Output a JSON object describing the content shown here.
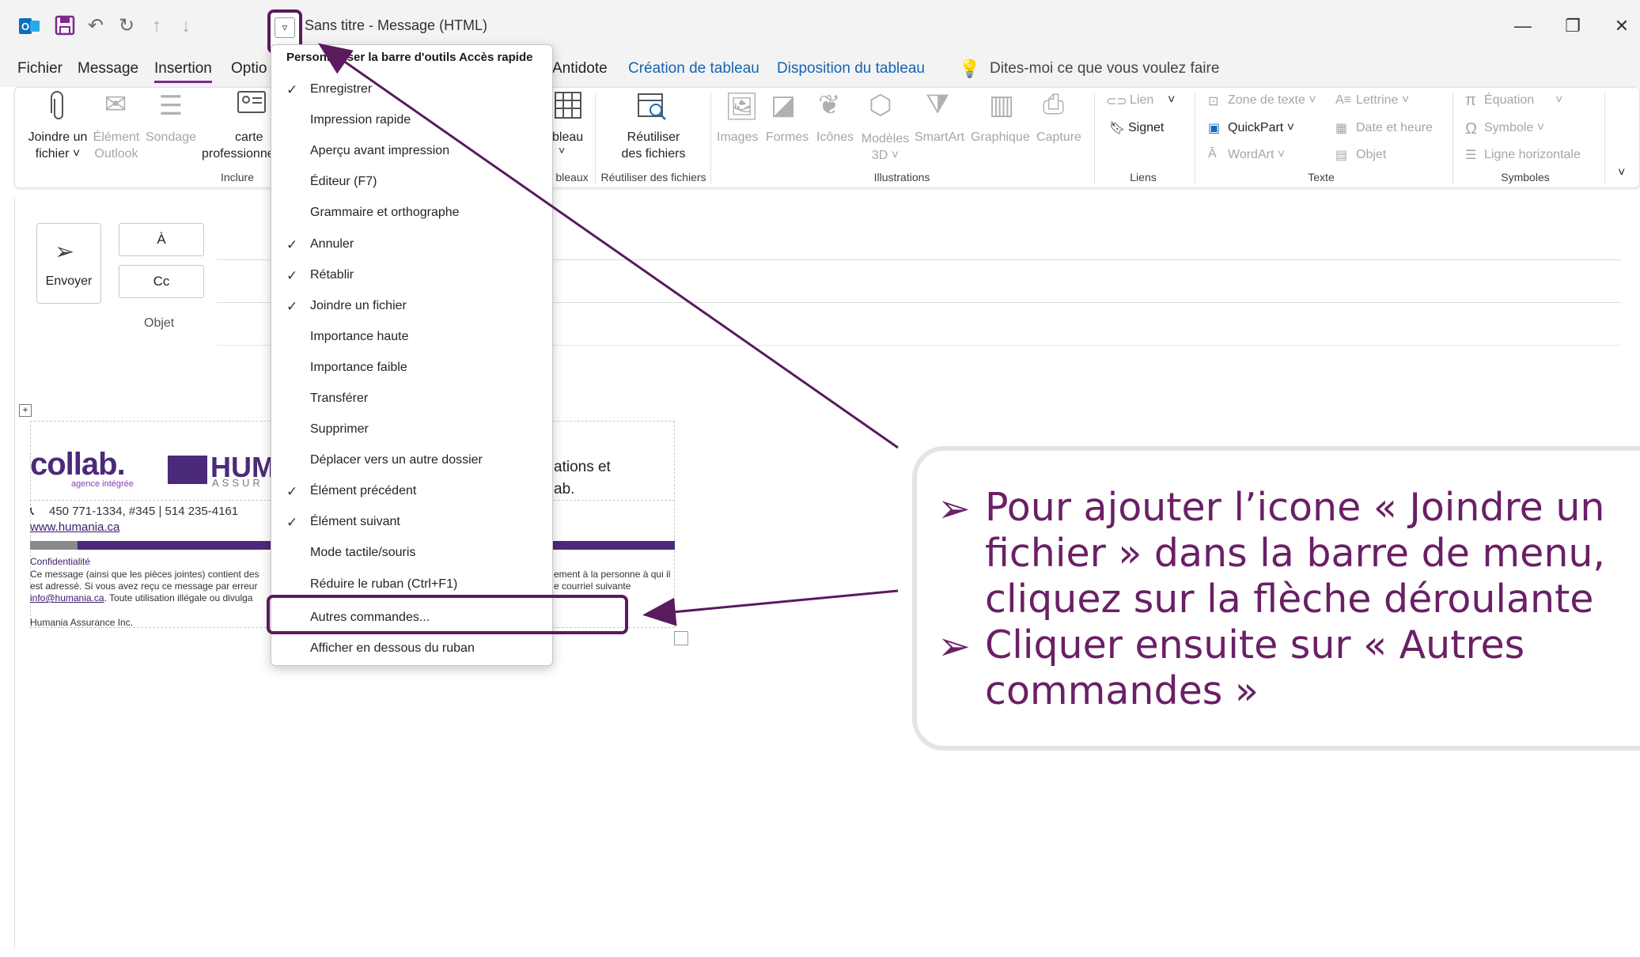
{
  "window": {
    "title": "Sans titre  -  Message (HTML)",
    "minimize": "—",
    "restore": "❐",
    "close": "✕"
  },
  "tabs": {
    "fichier": "Fichier",
    "message": "Message",
    "insertion": "Insertion",
    "options": "Optio",
    "antidote": "Antidote",
    "creation_tableau": "Création de tableau",
    "disposition_tableau": "Disposition du tableau",
    "tell_me": "Dites-moi ce que vous voulez faire"
  },
  "ribbon": {
    "joindre": "Joindre un",
    "joindre2": "fichier ˅",
    "element": "Élément",
    "element2": "Outlook",
    "sondage": "Sondage",
    "carte": "carte",
    "carte2": "professionne",
    "inclure": "Inclure",
    "tableau": "bleau",
    "tableaux": "bleaux",
    "reutiliser": "Réutiliser",
    "reutiliser2": "des fichiers",
    "reutiliser_group": "Réutiliser des fichiers",
    "images": "Images",
    "formes": "Formes",
    "icones": "Icônes",
    "modeles": "Modèles",
    "modeles2": "3D ˅",
    "smartart": "SmartArt",
    "graphique": "Graphique",
    "capture": "Capture",
    "illustrations": "Illustrations",
    "lien": "Lien",
    "signet": "Signet",
    "liens": "Liens",
    "zone_texte": "Zone de texte ˅",
    "lettrine": "Lettrine ˅",
    "quickpart": "QuickPart ˅",
    "date_heure": "Date et heure",
    "wordart": "WordArt ˅",
    "objet": "Objet",
    "texte": "Texte",
    "equation": "Équation",
    "symbole": "Symbole ˅",
    "ligne_horizontale": "Ligne horizontale",
    "symboles": "Symboles"
  },
  "compose": {
    "send": "Envoyer",
    "to": "À",
    "cc": "Cc",
    "subject": "Objet"
  },
  "signature": {
    "logo1": "collab.",
    "logo1_sub": "agence intégrée",
    "logo2": "HUM",
    "logo2_sub": "ASSUR",
    "side_text1": "ations et",
    "side_text2": "ab.",
    "phone": "450 771-1334, #345  |  514 235-4161",
    "website": "www.humania.ca",
    "conf_title": "Confidentialité",
    "conf_line1": "Ce message (ainsi que les pièces jointes) contient des",
    "conf_line1b": "ement à la personne à qui il",
    "conf_line2": "est adressé. Si vous avez reçu ce message par erreur",
    "conf_line2b": "e courriel suivante",
    "conf_email": "info@humania.ca",
    "conf_line3": ". Toute utilisation illégale ou divulga",
    "company": "Humania Assurance Inc."
  },
  "menu": {
    "title": "Personnaliser la barre d'outils Accès rapide",
    "items": [
      {
        "label": "Enregistrer",
        "checked": true
      },
      {
        "label": "Impression rapide",
        "checked": false
      },
      {
        "label": "Aperçu avant impression",
        "checked": false
      },
      {
        "label": "Éditeur (F7)",
        "checked": false
      },
      {
        "label": "Grammaire et orthographe",
        "checked": false
      },
      {
        "label": "Annuler",
        "checked": true
      },
      {
        "label": "Rétablir",
        "checked": true
      },
      {
        "label": "Joindre un fichier",
        "checked": true
      },
      {
        "label": "Importance haute",
        "checked": false
      },
      {
        "label": "Importance faible",
        "checked": false
      },
      {
        "label": "Transférer",
        "checked": false
      },
      {
        "label": "Supprimer",
        "checked": false
      },
      {
        "label": "Déplacer vers un autre dossier",
        "checked": false
      },
      {
        "label": "Élément précédent",
        "checked": true
      },
      {
        "label": "Élément suivant",
        "checked": true
      },
      {
        "label": "Mode tactile/souris",
        "checked": false
      },
      {
        "label": "Réduire le ruban (Ctrl+F1)",
        "checked": false
      },
      {
        "label": "Autres commandes...",
        "checked": false
      },
      {
        "label": "Afficher en dessous du ruban",
        "checked": false
      }
    ]
  },
  "callout": {
    "bullet": "➢",
    "line1": "Pour ajouter l’icone « Joindre un",
    "line2": "fichier » dans la barre de menu,",
    "line3": "cliquez sur la flèche déroulante",
    "line4": "Cliquer ensuite sur « Autres",
    "line5": "commandes »"
  },
  "colors": {
    "accent_purple": "#5a1a5e",
    "link_blue": "#1464b4",
    "callout_text": "#6a1f66"
  }
}
